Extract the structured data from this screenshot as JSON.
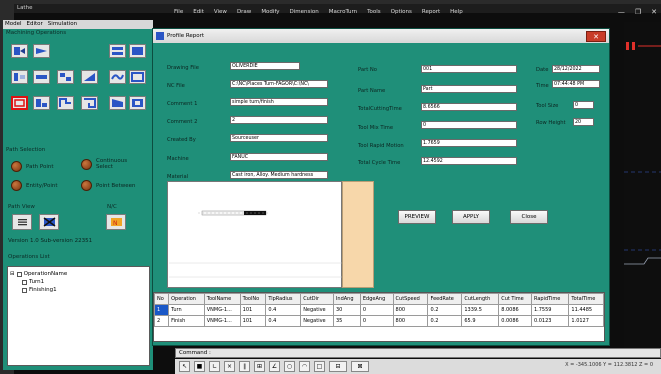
{
  "main_window": {
    "title": "Lathe",
    "menu": [
      "File",
      "Edit",
      "View",
      "Draw",
      "Modify",
      "Dimension",
      "MacroTurn",
      "Tools",
      "Options",
      "Report",
      "Help"
    ],
    "controls": [
      "—",
      "❐",
      "✕"
    ]
  },
  "left_panel": {
    "menu": [
      "Model",
      "Editor",
      "Simulation"
    ],
    "machining_operations_label": "Machining Operations",
    "path_selection_label": "Path Selection",
    "path_options": [
      "Path Point",
      "Continuous Select",
      "Entity/Point",
      "Point Between"
    ],
    "path_view_label": "Path View",
    "nc_label": "N/C",
    "version": "Version 1.0 Sub-version 22351",
    "operations_list_label": "Operations List",
    "tree": {
      "root": "OperationName",
      "children": [
        "Turn1",
        "Finishing1"
      ]
    }
  },
  "dialog": {
    "title": "Profile Report",
    "close": "✕",
    "left_fields": [
      {
        "label": "Drawing File",
        "value": "OLIVERDIE"
      },
      {
        "label": "NC File",
        "value": "C:\\NC\\Places Turn-FAGOR\\C:\\NC\\"
      },
      {
        "label": "Comment 1",
        "value": "simple turn/finish"
      },
      {
        "label": "Comment 2",
        "value": "2"
      },
      {
        "label": "Created By",
        "value": "Sourceuser"
      },
      {
        "label": "Machine",
        "value": "FANUC"
      },
      {
        "label": "Material",
        "value": "Cast iron, Alloy. Medium hardness"
      }
    ],
    "mid_fields": [
      {
        "label": "Part No",
        "value": "001"
      },
      {
        "label": "Part Name",
        "value": "Part"
      },
      {
        "label": "TotalCuttingTime",
        "value": "8.6566"
      },
      {
        "label": "Tool Mix Time",
        "value": "0"
      },
      {
        "label": "Tool Rapid Motion",
        "value": "1.7659"
      },
      {
        "label": "Total Cycle Time",
        "value": "12.4592"
      }
    ],
    "right_fields": [
      {
        "label": "Date",
        "value": "28/12/2022"
      },
      {
        "label": "Time",
        "value": "07:44:48 PM"
      },
      {
        "label": "Tool Size",
        "value": "0"
      },
      {
        "label": "Row Height",
        "value": "20"
      }
    ],
    "buttons": {
      "preview": "PREVIEW",
      "apply": "APPLY",
      "close": "Close"
    }
  },
  "table": {
    "headers": [
      "No",
      "Operation",
      "ToolName",
      "ToolNo",
      "TipRadius",
      "CutDir",
      "IndAng",
      "EdgeAng",
      "CutSpeed",
      "FeedRate",
      "CutLength",
      "Cut Time",
      "RapidTime",
      "TotalTime"
    ],
    "rows": [
      [
        "1",
        "Turn",
        "VNMG-1...",
        "101",
        "0.4",
        "Negative",
        "30",
        "0",
        "800",
        "0.2",
        "1339.5",
        "8.0086",
        "1.7559",
        "11.4485"
      ],
      [
        "2",
        "Finish",
        "VNMG-1...",
        "101",
        "0.4",
        "Negative",
        "35",
        "0",
        "800",
        "0.2",
        "65.9",
        "0.0086",
        "0.0123",
        "1.0127"
      ]
    ]
  },
  "command_label": "Command :",
  "coords": "X = -345.1006  Y = 112.3812  Z = 0"
}
